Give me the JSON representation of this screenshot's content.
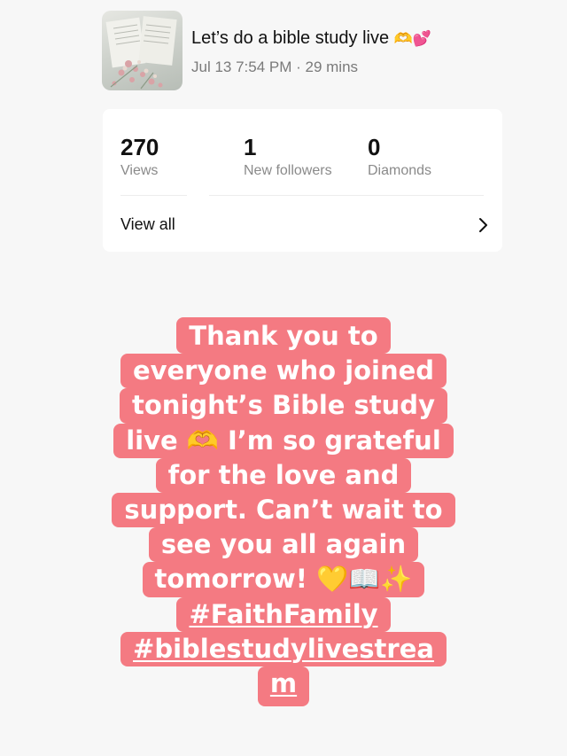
{
  "live": {
    "title": "Let’s do a bible study live",
    "title_emoji": "🫶💕",
    "meta": "Jul 13 7:54 PM · 29 mins"
  },
  "stats": [
    {
      "value": "270",
      "label": "Views"
    },
    {
      "value": "1",
      "label": "New followers"
    },
    {
      "value": "0",
      "label": "Diamonds"
    }
  ],
  "view_all_label": "View all",
  "caption": {
    "lines": [
      "Thank you to",
      "everyone who joined",
      "tonight’s Bible study",
      "live 🫶 I’m so grateful",
      "for the love and",
      "support. Can’t wait to",
      "see you all again",
      "tomorrow! 💛📖✨"
    ],
    "hashtags": [
      "#FaithFamily",
      "#biblestudylivestrea",
      "m"
    ],
    "background_color": "#f47a82",
    "text_color": "#ffffff"
  },
  "icons": {
    "chevron": "chevron-right-icon"
  }
}
